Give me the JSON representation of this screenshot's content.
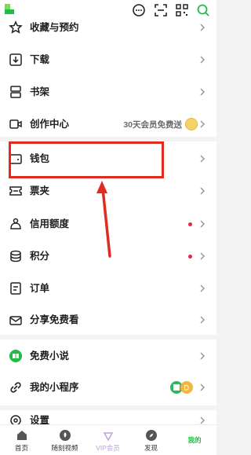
{
  "menu": {
    "items": [
      {
        "key": "favorites",
        "label": "收藏与预约"
      },
      {
        "key": "downloads",
        "label": "下载"
      },
      {
        "key": "bookshelf",
        "label": "书架"
      },
      {
        "key": "creator",
        "label": "创作中心",
        "promo": "30天会员免费送"
      },
      {
        "key": "wallet",
        "label": "钱包"
      },
      {
        "key": "tickets",
        "label": "票夹"
      },
      {
        "key": "credit",
        "label": "信用额度"
      },
      {
        "key": "points",
        "label": "积分"
      },
      {
        "key": "orders",
        "label": "订单"
      },
      {
        "key": "share",
        "label": "分享免费看"
      },
      {
        "key": "free_novels",
        "label": "免费小说"
      },
      {
        "key": "mini_programs",
        "label": "我的小程序"
      },
      {
        "key": "settings",
        "label": "设置"
      }
    ]
  },
  "tabbar": {
    "tabs": [
      {
        "label": "首页"
      },
      {
        "label": "随刻视频"
      },
      {
        "label": "VIP会员"
      },
      {
        "label": "发现"
      },
      {
        "label": "我的"
      }
    ]
  },
  "colors": {
    "accent": "#1fbd44",
    "highlight": "#e02b20",
    "badge_dot": "#e0294f"
  }
}
